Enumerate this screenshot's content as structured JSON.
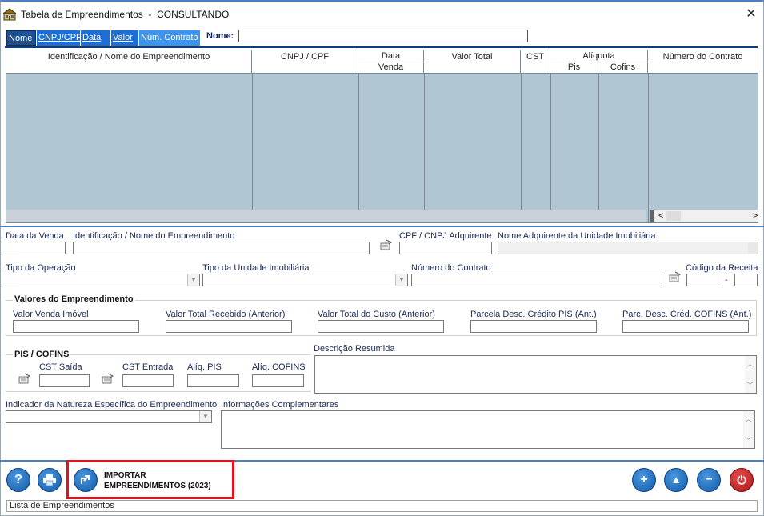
{
  "window": {
    "title": "Tabela de Empreendimentos  -  CONSULTANDO",
    "close_glyph": "✕"
  },
  "search": {
    "tabs": [
      "Nome",
      "CNPJ/CPF",
      "Data",
      "Valor",
      "Núm. Contrato"
    ],
    "name_label": "Nome:",
    "name_value": ""
  },
  "grid": {
    "headers": {
      "identificacao": "Identificação / Nome do Empreendimento",
      "cnpj": "CNPJ / CPF",
      "data": "Data",
      "data_sub": "Venda",
      "valor_total": "Valor Total",
      "cst": "CST",
      "aliquota": "Alíquota",
      "pis": "Pis",
      "cofins": "Cofins",
      "numero_contrato": "Número do Contrato"
    },
    "rows": []
  },
  "form": {
    "data_venda_label": "Data da Venda",
    "identificacao_label": "Identificação / Nome do Empreendimento",
    "cpf_cnpj_adquirente_label": "CPF / CNPJ Adquirente",
    "nome_adquirente_label": "Nome Adquirente da Unidade Imobiliária",
    "tipo_operacao_label": "Tipo da Operação",
    "tipo_unidade_label": "Tipo da Unidade Imobiliária",
    "numero_contrato_label": "Número do Contrato",
    "codigo_receita_label": "Código da Receita",
    "codigo_receita_sep": "-",
    "valores_group": "Valores do Empreendimento",
    "valor_venda_label": "Valor Venda Imóvel",
    "valor_total_recebido_label": "Valor Total Recebido (Anterior)",
    "valor_total_custo_label": "Valor Total do Custo (Anterior)",
    "parcela_pis_label": "Parcela Desc. Crédito PIS (Ant.)",
    "parc_cofins_label": "Parc. Desc. Créd. COFINS (Ant.)",
    "pis_cofins_group": "PIS / COFINS",
    "cst_saida_label": "CST Saída",
    "cst_entrada_label": "CST Entrada",
    "aliq_pis_label": "Alíq. PIS",
    "aliq_cofins_label": "Alíq. COFINS",
    "descricao_label": "Descrição Resumida",
    "indicador_label": "Indicador da Natureza Específica do Empreendimento",
    "informacoes_label": "Informações Complementares"
  },
  "toolbar": {
    "import_line1": "IMPORTAR",
    "import_line2": "EMPREENDIMENTOS (2023)",
    "help_glyph": "?",
    "add_glyph": "+",
    "up_glyph": "▲",
    "remove_glyph": "−",
    "power_glyph": "⏻"
  },
  "status": {
    "text": "Lista de Empreendimentos"
  },
  "colors": {
    "accent": "#1b4f96",
    "grid_bg": "#b1c6d3",
    "highlight": "#e0141e"
  }
}
